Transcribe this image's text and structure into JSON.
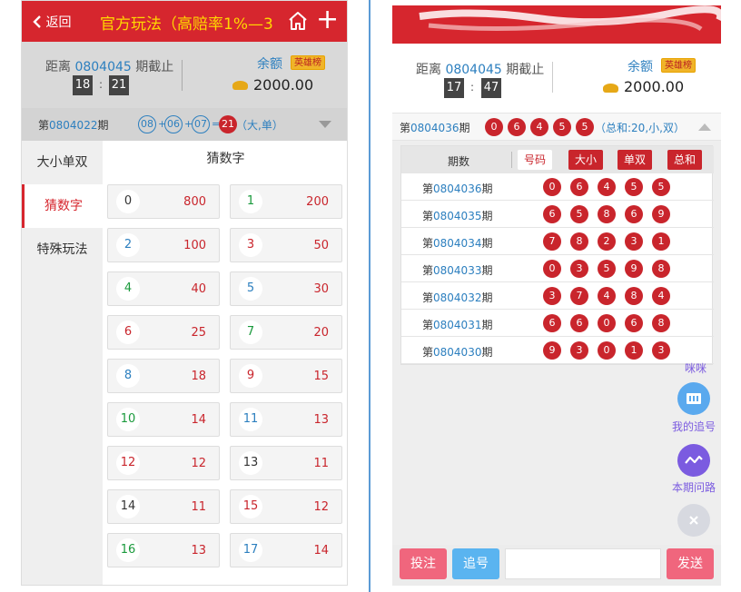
{
  "left": {
    "header": {
      "back_label": "返回",
      "title": "官方玩法（高赔率1%—3"
    },
    "info": {
      "distance_prefix": "距离",
      "issue": "0804045",
      "distance_suffix": "期截止",
      "min": "18",
      "sec": "21",
      "balance_label": "余额",
      "badge": "英雄榜",
      "balance": "2000.00"
    },
    "last": {
      "prefix": "第",
      "issue": "0804022",
      "suffix": "期",
      "balls": [
        "08",
        "06",
        "07"
      ],
      "sum": "21",
      "tag": "（大,单）"
    },
    "sidebar": [
      {
        "label": "大小单双"
      },
      {
        "label": "猜数字"
      },
      {
        "label": "特殊玩法"
      }
    ],
    "guess_title": "猜数字",
    "cells": [
      {
        "n": "0",
        "o": "800",
        "c": "#333"
      },
      {
        "n": "1",
        "o": "200",
        "c": "#1a9a3c"
      },
      {
        "n": "2",
        "o": "100",
        "c": "#2c7fbf"
      },
      {
        "n": "3",
        "o": "50",
        "c": "#c9252c"
      },
      {
        "n": "4",
        "o": "40",
        "c": "#1a9a3c"
      },
      {
        "n": "5",
        "o": "30",
        "c": "#2c7fbf"
      },
      {
        "n": "6",
        "o": "25",
        "c": "#c9252c"
      },
      {
        "n": "7",
        "o": "20",
        "c": "#1a9a3c"
      },
      {
        "n": "8",
        "o": "18",
        "c": "#2c7fbf"
      },
      {
        "n": "9",
        "o": "15",
        "c": "#c9252c"
      },
      {
        "n": "10",
        "o": "14",
        "c": "#1a9a3c"
      },
      {
        "n": "11",
        "o": "13",
        "c": "#2c7fbf"
      },
      {
        "n": "12",
        "o": "12",
        "c": "#c9252c"
      },
      {
        "n": "13",
        "o": "11",
        "c": "#333"
      },
      {
        "n": "14",
        "o": "11",
        "c": "#333"
      },
      {
        "n": "15",
        "o": "12",
        "c": "#c9252c"
      },
      {
        "n": "16",
        "o": "13",
        "c": "#1a9a3c"
      },
      {
        "n": "17",
        "o": "14",
        "c": "#2c7fbf"
      }
    ]
  },
  "right": {
    "info": {
      "distance_prefix": "距离",
      "issue": "0804045",
      "distance_suffix": "期截止",
      "min": "17",
      "sec": "47",
      "balance_label": "余额",
      "badge": "英雄榜",
      "balance": "2000.00"
    },
    "last": {
      "prefix": "第",
      "issue": "0804036",
      "suffix": "期",
      "balls": [
        "0",
        "6",
        "4",
        "5",
        "5"
      ],
      "tag": "（总和:20,小,双）"
    },
    "table": {
      "col_issue": "期数",
      "tabs": [
        "号码",
        "大小",
        "单双",
        "总和"
      ],
      "rows": [
        {
          "issue": "0804036",
          "balls": [
            "0",
            "6",
            "4",
            "5",
            "5"
          ]
        },
        {
          "issue": "0804035",
          "balls": [
            "6",
            "5",
            "8",
            "6",
            "9"
          ]
        },
        {
          "issue": "0804034",
          "balls": [
            "7",
            "8",
            "2",
            "3",
            "1"
          ]
        },
        {
          "issue": "0804033",
          "balls": [
            "0",
            "3",
            "5",
            "9",
            "8"
          ]
        },
        {
          "issue": "0804032",
          "balls": [
            "3",
            "7",
            "4",
            "8",
            "4"
          ]
        },
        {
          "issue": "0804031",
          "balls": [
            "6",
            "6",
            "0",
            "6",
            "8"
          ]
        },
        {
          "issue": "0804030",
          "balls": [
            "9",
            "3",
            "0",
            "1",
            "3"
          ]
        }
      ]
    },
    "fabs": {
      "partial_label": "咪咪",
      "track_label": "我的追号",
      "road_label": "本期问路"
    },
    "footer": {
      "bet": "投注",
      "track": "追号",
      "send": "发送"
    },
    "colors": {
      "red": "#c9252c",
      "blue": "#2c7fbf",
      "purple": "#7b5be0",
      "pink": "#f0667d",
      "lightblue": "#5ab4f0"
    }
  }
}
